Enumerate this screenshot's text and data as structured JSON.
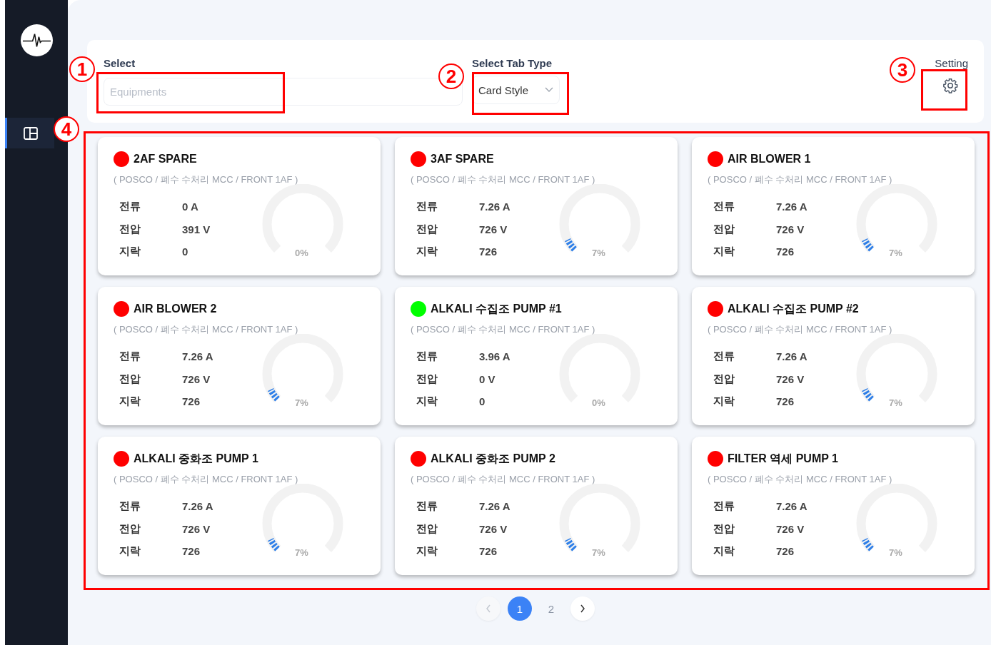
{
  "sidebar": {
    "nav_items": [
      {
        "selected": true
      }
    ]
  },
  "filters": {
    "select_label": "Select",
    "select_placeholder": "Equipments",
    "tab_type_label": "Select Tab Type",
    "tab_type_value": "Card Style",
    "setting_label": "Setting"
  },
  "cards": [
    {
      "name": "2AF SPARE",
      "color": "#ff0000",
      "location": "( POSCO / 폐수 수처리 MCC / FRONT 1AF )",
      "metrics": [
        {
          "label": "전류",
          "value": "0 A"
        },
        {
          "label": "전압",
          "value": "391 V"
        },
        {
          "label": "지락",
          "value": "0"
        }
      ],
      "gauge": {
        "reading": "0%"
      }
    },
    {
      "name": "3AF SPARE",
      "color": "#ff0000",
      "location": "( POSCO / 폐수 수처리 MCC / FRONT 1AF )",
      "metrics": [
        {
          "label": "전류",
          "value": "7.26 A"
        },
        {
          "label": "전압",
          "value": "726 V"
        },
        {
          "label": "지락",
          "value": "726"
        }
      ],
      "gauge": {
        "reading": "7%"
      }
    },
    {
      "name": "AIR BLOWER 1",
      "color": "#ff0000",
      "location": "( POSCO / 폐수 수처리 MCC / FRONT 1AF )",
      "metrics": [
        {
          "label": "전류",
          "value": "7.26 A"
        },
        {
          "label": "전압",
          "value": "726 V"
        },
        {
          "label": "지락",
          "value": "726"
        }
      ],
      "gauge": {
        "reading": "7%"
      }
    },
    {
      "name": "AIR BLOWER 2",
      "color": "#ff0000",
      "location": "( POSCO / 폐수 수처리 MCC / FRONT 1AF )",
      "metrics": [
        {
          "label": "전류",
          "value": "7.26 A"
        },
        {
          "label": "전압",
          "value": "726 V"
        },
        {
          "label": "지락",
          "value": "726"
        }
      ],
      "gauge": {
        "reading": "7%"
      }
    },
    {
      "name": "ALKALI 수집조 PUMP #1",
      "color": "#00ff00",
      "location": "( POSCO / 폐수 수처리 MCC / FRONT 1AF )",
      "metrics": [
        {
          "label": "전류",
          "value": "3.96 A"
        },
        {
          "label": "전압",
          "value": "0 V"
        },
        {
          "label": "지락",
          "value": "0"
        }
      ],
      "gauge": {
        "reading": "0%"
      }
    },
    {
      "name": "ALKALI 수집조 PUMP #2",
      "color": "#ff0000",
      "location": "( POSCO / 폐수 수처리 MCC / FRONT 1AF )",
      "metrics": [
        {
          "label": "전류",
          "value": "7.26 A"
        },
        {
          "label": "전압",
          "value": "726 V"
        },
        {
          "label": "지락",
          "value": "726"
        }
      ],
      "gauge": {
        "reading": "7%"
      }
    },
    {
      "name": "ALKALI 중화조 PUMP 1",
      "color": "#ff0000",
      "location": "( POSCO / 폐수 수처리 MCC / FRONT 1AF )",
      "metrics": [
        {
          "label": "전류",
          "value": "7.26 A"
        },
        {
          "label": "전압",
          "value": "726 V"
        },
        {
          "label": "지락",
          "value": "726"
        }
      ],
      "gauge": {
        "reading": "7%"
      }
    },
    {
      "name": "ALKALI 중화조 PUMP 2",
      "color": "#ff0000",
      "location": "( POSCO / 폐수 수처리 MCC / FRONT 1AF )",
      "metrics": [
        {
          "label": "전류",
          "value": "7.26 A"
        },
        {
          "label": "전압",
          "value": "726 V"
        },
        {
          "label": "지락",
          "value": "726"
        }
      ],
      "gauge": {
        "reading": "7%"
      }
    },
    {
      "name": "FILTER 역세 PUMP 1",
      "color": "#ff0000",
      "location": "( POSCO / 폐수 수처리 MCC / FRONT 1AF )",
      "metrics": [
        {
          "label": "전류",
          "value": "7.26 A"
        },
        {
          "label": "전압",
          "value": "726 V"
        },
        {
          "label": "지락",
          "value": "726"
        }
      ],
      "gauge": {
        "reading": "7%"
      }
    }
  ],
  "pagination": {
    "prev": {
      "disabled": true
    },
    "pages": [
      {
        "label": "1",
        "selected": true
      },
      {
        "label": "2",
        "selected": false
      }
    ],
    "next": {
      "disabled": false
    }
  },
  "annotations": [
    {
      "label": "1"
    },
    {
      "label": "2"
    },
    {
      "label": "3"
    },
    {
      "label": "4"
    }
  ]
}
